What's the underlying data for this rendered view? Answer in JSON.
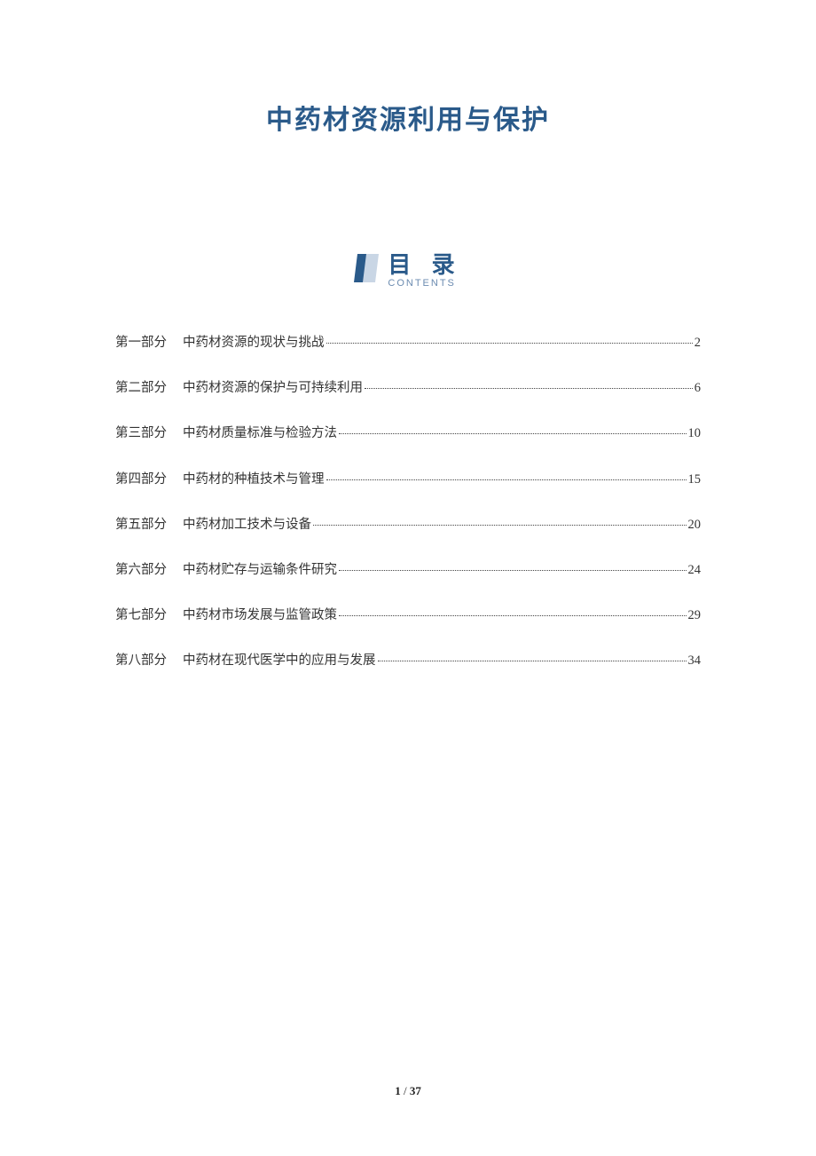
{
  "title": "中药材资源利用与保护",
  "toc": {
    "heading_cn": "目 录",
    "heading_en": "CONTENTS",
    "entries": [
      {
        "part": "第一部分",
        "title": "中药材资源的现状与挑战",
        "page": "2"
      },
      {
        "part": "第二部分",
        "title": "中药材资源的保护与可持续利用",
        "page": "6"
      },
      {
        "part": "第三部分",
        "title": "中药材质量标准与检验方法",
        "page": "10"
      },
      {
        "part": "第四部分",
        "title": "中药材的种植技术与管理",
        "page": "15"
      },
      {
        "part": "第五部分",
        "title": "中药材加工技术与设备",
        "page": "20"
      },
      {
        "part": "第六部分",
        "title": "中药材贮存与运输条件研究",
        "page": "24"
      },
      {
        "part": "第七部分",
        "title": "中药材市场发展与监管政策",
        "page": "29"
      },
      {
        "part": "第八部分",
        "title": "中药材在现代医学中的应用与发展",
        "page": "34"
      }
    ]
  },
  "footer": {
    "current_page": "1",
    "separator": " / ",
    "total_pages": "37"
  }
}
